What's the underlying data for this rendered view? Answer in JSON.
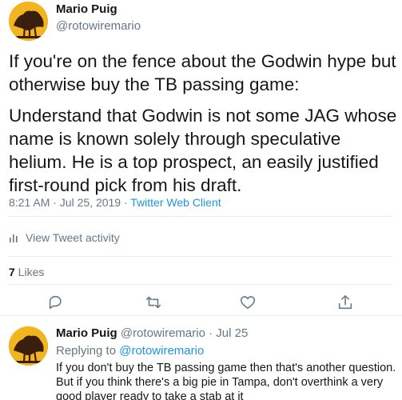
{
  "main_tweet": {
    "author_name": "Mario Puig",
    "author_handle": "@rotowiremario",
    "text_paragraph_1": "If you're on the fence about the Godwin hype but otherwise buy the TB passing game:",
    "text_paragraph_2": "Understand that Godwin is not some JAG whose name is known solely through speculative helium. He is a top prospect, an easily justified first-round pick from his draft.",
    "timestamp": "8:21 AM · Jul 25, 2019 · ",
    "client": "Twitter Web Client",
    "activity_label": "View Tweet activity",
    "likes_count": "7",
    "likes_label": " Likes"
  },
  "actions": {
    "reply_icon": "reply-icon",
    "retweet_icon": "retweet-icon",
    "like_icon": "heart-icon",
    "share_icon": "share-icon"
  },
  "reply_tweet": {
    "author_name": "Mario Puig",
    "meta": " @rotowiremario · Jul 25",
    "replying_prefix": "Replying to ",
    "replying_to": "@rotowiremario",
    "text": "If you don't buy the TB passing game then that's another question. But if you think there's a big pie in Tampa, don't overthink a very good player ready to take a stab at it"
  },
  "colors": {
    "text": "#14171a",
    "muted": "#657786",
    "link": "#1b95e0",
    "divider": "#e6ecf0",
    "avatar_bg": "#f2b51f"
  }
}
